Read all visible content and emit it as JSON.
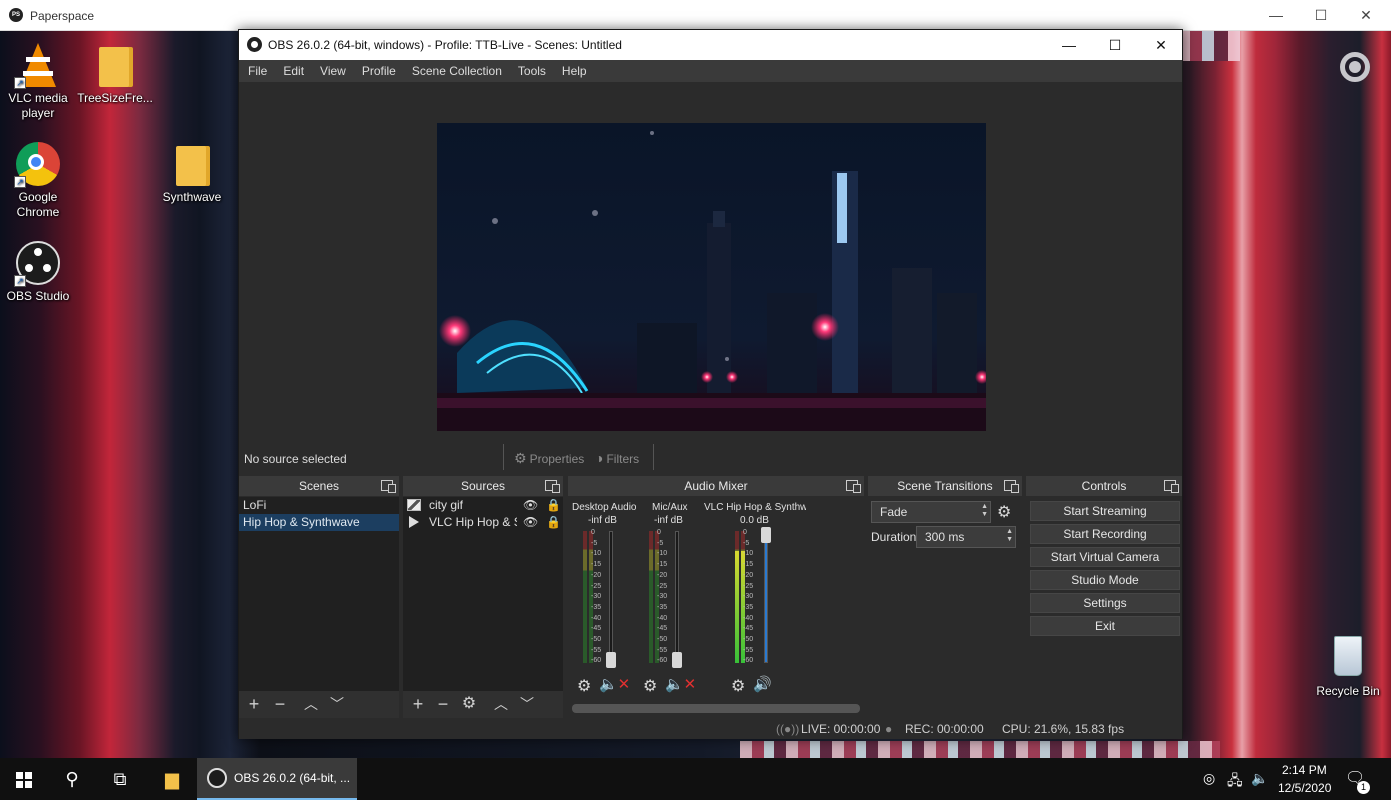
{
  "paperspace": {
    "title": "Paperspace",
    "logo": "PS",
    "minimize": "—",
    "maximize": "☐",
    "close": "✕"
  },
  "desktop": {
    "icons": [
      {
        "label": "VLC media player"
      },
      {
        "label": "TreeSizeFre..."
      },
      {
        "label": "Google Chrome"
      },
      {
        "label": "Synthwave"
      },
      {
        "label": "OBS Studio"
      },
      {
        "label": "Recycle Bin"
      }
    ]
  },
  "obs": {
    "title": "OBS 26.0.2 (64-bit, windows) - Profile: TTB-Live - Scenes: Untitled",
    "minimize": "—",
    "maximize": "☐",
    "close": "✕",
    "menu": [
      "File",
      "Edit",
      "View",
      "Profile",
      "Scene Collection",
      "Tools",
      "Help"
    ],
    "source_toolbar": {
      "status": "No source selected",
      "properties": "Properties",
      "filters": "Filters"
    },
    "scenes": {
      "title": "Scenes",
      "items": [
        "LoFi",
        "Hip Hop & Synthwave"
      ],
      "selected_index": 1
    },
    "sources": {
      "title": "Sources",
      "items": [
        "city gif",
        "VLC Hip Hop & Synthwave"
      ]
    },
    "mixer": {
      "title": "Audio Mixer",
      "scale": [
        "0",
        "-5",
        "-10",
        "-15",
        "-20",
        "-25",
        "-30",
        "-35",
        "-40",
        "-45",
        "-50",
        "-55",
        "-60"
      ],
      "channels": [
        {
          "name": "Desktop Audio",
          "db": "-inf dB",
          "muted": true,
          "level": 0
        },
        {
          "name": "Mic/Aux",
          "db": "-inf dB",
          "muted": true,
          "level": 0
        },
        {
          "name": "VLC Hip Hop & Synthwave",
          "db": "0.0 dB",
          "muted": false,
          "level": 0.85
        }
      ]
    },
    "transitions": {
      "title": "Scene Transitions",
      "selected": "Fade",
      "duration_label": "Duration",
      "duration_value": "300 ms"
    },
    "controls": {
      "title": "Controls",
      "buttons": [
        "Start Streaming",
        "Start Recording",
        "Start Virtual Camera",
        "Studio Mode",
        "Settings",
        "Exit"
      ]
    },
    "status": {
      "live": "LIVE: 00:00:00",
      "rec": "REC: 00:00:00",
      "cpu": "CPU: 21.6%, 15.83 fps"
    }
  },
  "taskbar": {
    "obs_label": "OBS 26.0.2 (64-bit, ...",
    "time": "2:14 PM",
    "date": "12/5/2020",
    "notification_count": "1"
  }
}
